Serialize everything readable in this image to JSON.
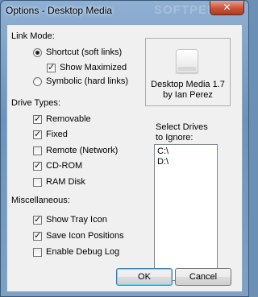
{
  "window": {
    "title": "Options - Desktop Media",
    "watermark": "SOFTPEDIA",
    "close_glyph": "✕"
  },
  "link_mode": {
    "label": "Link Mode:",
    "shortcut": {
      "label": "Shortcut (soft links)",
      "selected": true
    },
    "show_maximized": {
      "label": "Show Maximized",
      "checked": true
    },
    "symbolic": {
      "label": "Symbolic (hard links)",
      "selected": false
    }
  },
  "about": {
    "icon": "drive-icon",
    "line1": "Desktop Media 1.7",
    "line2": "by Ian Perez"
  },
  "drive_types": {
    "label": "Drive Types:",
    "items": [
      {
        "label": "Removable",
        "checked": true
      },
      {
        "label": "Fixed",
        "checked": true
      },
      {
        "label": "Remote (Network)",
        "checked": false
      },
      {
        "label": "CD-ROM",
        "checked": true
      },
      {
        "label": "RAM Disk",
        "checked": false
      }
    ]
  },
  "ignore": {
    "label_line1": "Select Drives",
    "label_line2": "to Ignore:",
    "items": [
      "C:\\",
      "D:\\"
    ]
  },
  "misc": {
    "label": "Miscellaneous:",
    "items": [
      {
        "label": "Show Tray Icon",
        "checked": true
      },
      {
        "label": "Save Icon Positions",
        "checked": true
      },
      {
        "label": "Enable Debug Log",
        "checked": false
      }
    ]
  },
  "buttons": {
    "ok": "OK",
    "cancel": "Cancel"
  }
}
